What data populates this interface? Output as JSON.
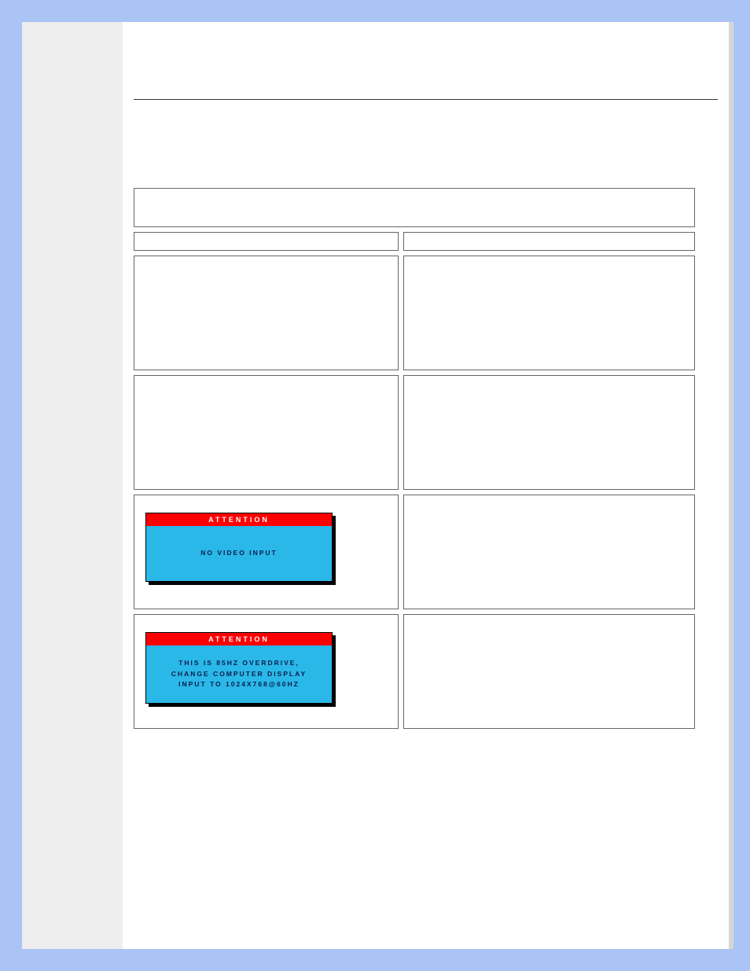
{
  "header_row": "",
  "subheader_left": "",
  "subheader_right": "",
  "row1_left": "",
  "row1_right": "",
  "row2_left": "",
  "row2_right": "",
  "row3_right": "",
  "row4_right": "",
  "attention1": {
    "title": "ATTENTION",
    "body": "NO VIDEO INPUT"
  },
  "attention2": {
    "title": "ATTENTION",
    "line1": "THIS IS 85HZ OVERDRIVE,",
    "line2": "CHANGE COMPUTER DISPLAY",
    "line3": "INPUT TO 1024X768@60HZ"
  }
}
